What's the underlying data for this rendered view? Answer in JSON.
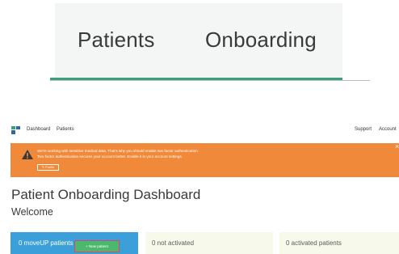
{
  "zoom": {
    "tab1": "Patients",
    "tab2": "Onboarding"
  },
  "nav": {
    "dashboard": "Dashboard",
    "patients": "Patients",
    "support": "Support",
    "account": "Account"
  },
  "alert": {
    "line1": "We're working with sensitive medical data. That's why you should enable two factor authentication.",
    "line2": "Two factor authentication secures your account better. Enable it in your account settings.",
    "profile_label": "✎ Profile",
    "close": "×"
  },
  "page": {
    "title": "Patient Onboarding Dashboard",
    "subtitle": "Welcome"
  },
  "cards": {
    "moveup": "0 moveUP patients",
    "new_patient": "+ New patient",
    "not_activated": "0 not activated",
    "activated": "0 activated patients"
  },
  "colors": {
    "accent": "#3d9f80",
    "alert": "#f0893a",
    "card_blue": "#3b9fd9",
    "button_green": "#4bb86e",
    "highlight": "#e0446d"
  }
}
